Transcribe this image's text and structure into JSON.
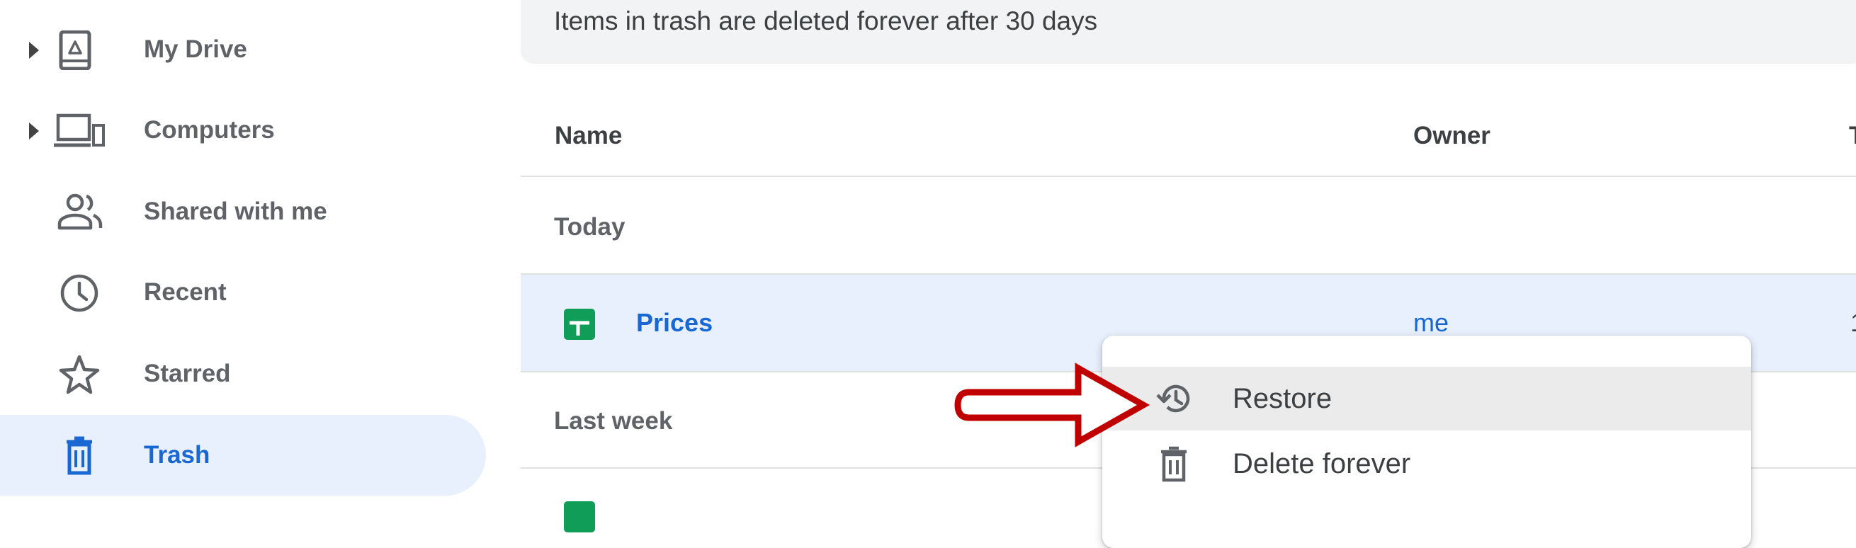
{
  "sidebar": {
    "items": [
      {
        "label": "My Drive",
        "icon": "my-drive-icon",
        "expandable": true
      },
      {
        "label": "Computers",
        "icon": "computers-icon",
        "expandable": true
      },
      {
        "label": "Shared with me",
        "icon": "shared-with-me-icon",
        "expandable": false
      },
      {
        "label": "Recent",
        "icon": "clock-icon",
        "expandable": false
      },
      {
        "label": "Starred",
        "icon": "star-icon",
        "expandable": false
      },
      {
        "label": "Trash",
        "icon": "trash-icon",
        "expandable": false,
        "active": true
      }
    ]
  },
  "main": {
    "banner": "Items in trash are deleted forever after 30 days",
    "columns": [
      "Name",
      "Owner",
      "T"
    ],
    "sections": [
      {
        "label": "Today",
        "rows": [
          {
            "name": "Prices",
            "owner": "me",
            "trash_date_fragment": "1",
            "icon": "google-sheets-icon",
            "selected": true
          }
        ]
      },
      {
        "label": "Last week",
        "rows": []
      }
    ]
  },
  "context_menu": {
    "items": [
      {
        "label": "Restore",
        "icon": "restore-history-icon",
        "hovered": true
      },
      {
        "label": "Delete forever",
        "icon": "trash-icon"
      }
    ]
  },
  "annotation": {
    "type": "arrow",
    "color": "#c00000",
    "points_to": "Restore"
  },
  "colors": {
    "accent": "#1967d2",
    "selected_bg": "#e8f0fe",
    "sheets_green": "#0f9d58",
    "annotation_red": "#c00000"
  }
}
